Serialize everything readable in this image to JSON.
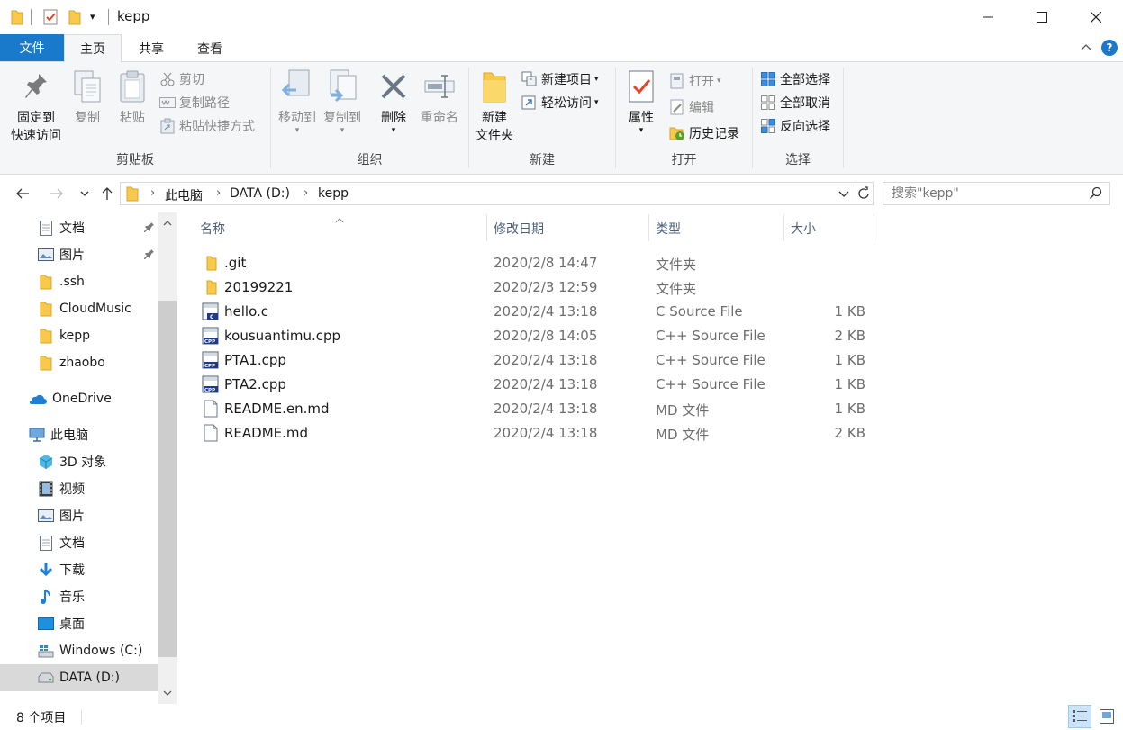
{
  "window": {
    "title": "kepp"
  },
  "ribbon_tabs": [
    {
      "label": "文件"
    },
    {
      "label": "主页"
    },
    {
      "label": "共享"
    },
    {
      "label": "查看"
    }
  ],
  "ribbon": {
    "clipboard": {
      "label": "剪贴板",
      "pin_line1": "固定到",
      "pin_line2": "快速访问",
      "copy": "复制",
      "paste": "粘贴",
      "cut": "剪切",
      "copy_path": "复制路径",
      "paste_shortcut": "粘贴快捷方式"
    },
    "organize": {
      "label": "组织",
      "move_to": "移动到",
      "copy_to": "复制到",
      "delete": "删除",
      "rename": "重命名"
    },
    "new": {
      "label": "新建",
      "new_folder_line1": "新建",
      "new_folder_line2": "文件夹",
      "new_item": "新建项目",
      "easy_access": "轻松访问"
    },
    "open": {
      "label": "打开",
      "properties": "属性",
      "open": "打开",
      "edit": "编辑",
      "history": "历史记录"
    },
    "select": {
      "label": "选择",
      "select_all": "全部选择",
      "select_none": "全部取消",
      "invert": "反向选择"
    }
  },
  "address": {
    "crumbs": [
      "此电脑",
      "DATA (D:)",
      "kepp"
    ],
    "search_placeholder": "搜索\"kepp\""
  },
  "nav": {
    "quick_access": [
      {
        "label": "文档",
        "icon": "document-icon",
        "pinned": true
      },
      {
        "label": "图片",
        "icon": "picture-icon",
        "pinned": true
      },
      {
        "label": ".ssh",
        "icon": "folder-icon",
        "pinned": false
      },
      {
        "label": "CloudMusic",
        "icon": "folder-icon",
        "pinned": false
      },
      {
        "label": "kepp",
        "icon": "folder-icon",
        "pinned": false
      },
      {
        "label": "zhaobo",
        "icon": "folder-icon",
        "pinned": false
      }
    ],
    "onedrive": "OneDrive",
    "this_pc": "此电脑",
    "pc_items": [
      {
        "label": "3D 对象",
        "icon": "3d-objects-icon"
      },
      {
        "label": "视频",
        "icon": "video-icon"
      },
      {
        "label": "图片",
        "icon": "picture-icon"
      },
      {
        "label": "文档",
        "icon": "document-icon"
      },
      {
        "label": "下载",
        "icon": "download-icon"
      },
      {
        "label": "音乐",
        "icon": "music-icon"
      },
      {
        "label": "桌面",
        "icon": "desktop-icon"
      },
      {
        "label": "Windows (C:)",
        "icon": "windows-drive-icon"
      },
      {
        "label": "DATA (D:)",
        "icon": "drive-icon"
      }
    ]
  },
  "columns": {
    "name": "名称",
    "date": "修改日期",
    "type": "类型",
    "size": "大小"
  },
  "files": [
    {
      "name": ".git",
      "date": "2020/2/8 14:47",
      "type": "文件夹",
      "size": "",
      "icon": "folder-icon"
    },
    {
      "name": "20199221",
      "date": "2020/2/3 12:59",
      "type": "文件夹",
      "size": "",
      "icon": "folder-icon"
    },
    {
      "name": "hello.c",
      "date": "2020/2/4 13:18",
      "type": "C Source File",
      "size": "1 KB",
      "icon": "c-file-icon"
    },
    {
      "name": "kousuantimu.cpp",
      "date": "2020/2/8 14:05",
      "type": "C++ Source File",
      "size": "2 KB",
      "icon": "cpp-file-icon"
    },
    {
      "name": "PTA1.cpp",
      "date": "2020/2/4 13:18",
      "type": "C++ Source File",
      "size": "1 KB",
      "icon": "cpp-file-icon"
    },
    {
      "name": "PTA2.cpp",
      "date": "2020/2/4 13:18",
      "type": "C++ Source File",
      "size": "1 KB",
      "icon": "cpp-file-icon"
    },
    {
      "name": "README.en.md",
      "date": "2020/2/4 13:18",
      "type": "MD 文件",
      "size": "1 KB",
      "icon": "text-file-icon"
    },
    {
      "name": "README.md",
      "date": "2020/2/4 13:18",
      "type": "MD 文件",
      "size": "2 KB",
      "icon": "text-file-icon"
    }
  ],
  "status": {
    "count": "8 个项目"
  },
  "colors": {
    "accent": "#1979ca",
    "folder": "#f8c94a",
    "selected_nav": "#d9d9d9"
  }
}
